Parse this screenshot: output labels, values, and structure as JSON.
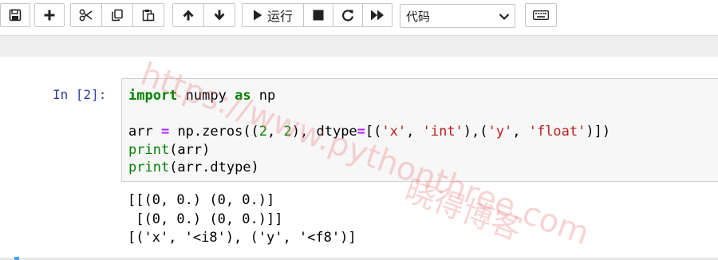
{
  "toolbar": {
    "run_label": "运行",
    "cell_type_selected": "代码",
    "icons": [
      "save-icon",
      "plus-icon",
      "cut-icon",
      "copy-icon",
      "paste-icon",
      "arrow-up-icon",
      "arrow-down-icon",
      "run-icon",
      "stop-icon",
      "restart-icon",
      "fast-forward-icon",
      "chevron-down-icon",
      "keyboard-icon"
    ]
  },
  "cell": {
    "prompt": "In [2]:",
    "code_lines": [
      "import numpy as np",
      "",
      "arr = np.zeros((2, 2), dtype=[('x', 'int'),('y', 'float')])",
      "print(arr)",
      "print(arr.dtype)"
    ],
    "output_lines": [
      "[[(0, 0.) (0, 0.)]",
      " [(0, 0.) (0, 0.)]]",
      "[('x', '<i8'), ('y', '<f8')]"
    ]
  },
  "watermark": {
    "url": "https://www.pythonthree.com",
    "site_name": "晓得博客"
  },
  "colors": {
    "prompt": "#303f9f",
    "keyword": "#008000",
    "operator": "#aa22ff",
    "string": "#ba2121",
    "accent": "#42a5f5"
  }
}
